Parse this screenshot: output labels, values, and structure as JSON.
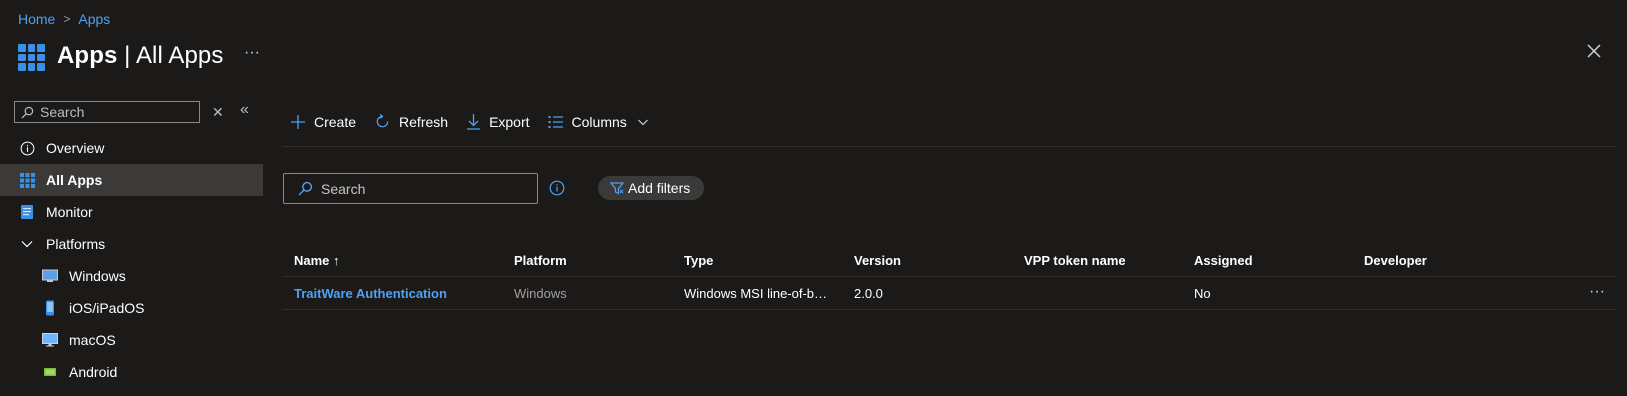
{
  "breadcrumb": {
    "home": "Home",
    "separator": ">",
    "current": "Apps"
  },
  "header": {
    "title_bold": "Apps",
    "title_rest": " | All Apps",
    "more": "···"
  },
  "sidebar": {
    "search_placeholder": "Search",
    "clear": "✕",
    "collapse": "«",
    "items": [
      {
        "label": "Overview",
        "icon": "info-icon"
      },
      {
        "label": "All Apps",
        "icon": "apps-grid-icon",
        "selected": true
      },
      {
        "label": "Monitor",
        "icon": "monitor-icon"
      },
      {
        "label": "Platforms",
        "icon": "chevron-down-icon"
      },
      {
        "label": "Windows",
        "icon": "windows-device-icon"
      },
      {
        "label": "iOS/iPadOS",
        "icon": "ios-device-icon"
      },
      {
        "label": "macOS",
        "icon": "macos-device-icon"
      },
      {
        "label": "Android",
        "icon": "android-device-icon"
      }
    ]
  },
  "toolbar": {
    "create": "Create",
    "refresh": "Refresh",
    "export": "Export",
    "columns": "Columns"
  },
  "filters": {
    "search_placeholder": "Search",
    "add_filters": "Add filters"
  },
  "table": {
    "headers": [
      "Name ↑",
      "Platform",
      "Type",
      "Version",
      "VPP token name",
      "Assigned",
      "Developer"
    ],
    "rows": [
      {
        "name": "TraitWare Authentication",
        "platform": "Windows",
        "type": "Windows MSI line-of-business app",
        "version": "2.0.0",
        "vpp": "",
        "assigned": "No",
        "developer": "",
        "more": "···"
      }
    ]
  },
  "colors": {
    "accent": "#4ea1f3",
    "background": "#1b1a19",
    "selected": "#3b3a39"
  }
}
